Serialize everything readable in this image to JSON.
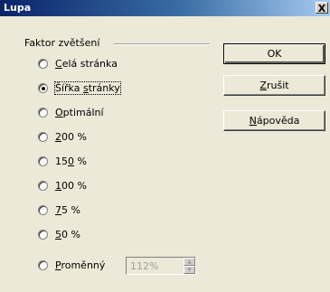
{
  "window": {
    "title": "Lupa",
    "close_label": "X"
  },
  "group": {
    "label": "Faktor zvětšení"
  },
  "options": [
    {
      "pre": "",
      "ul": "C",
      "post": "elá stránka",
      "checked": false
    },
    {
      "pre": "Šířka ",
      "ul": "s",
      "post": "tránky",
      "checked": true
    },
    {
      "pre": "",
      "ul": "O",
      "post": "ptimální",
      "checked": false
    },
    {
      "pre": "",
      "ul": "2",
      "post": "00 %",
      "checked": false
    },
    {
      "pre": "15",
      "ul": "0",
      "post": " %",
      "checked": false
    },
    {
      "pre": "",
      "ul": "1",
      "post": "00 %",
      "checked": false
    },
    {
      "pre": "",
      "ul": "7",
      "post": "5 %",
      "checked": false
    },
    {
      "pre": "",
      "ul": "5",
      "post": "0 %",
      "checked": false
    },
    {
      "pre": "",
      "ul": "P",
      "post": "roměnný",
      "checked": false
    }
  ],
  "variable_zoom": {
    "value": "112%"
  },
  "buttons": {
    "ok": "OK",
    "cancel_ul": "Z",
    "cancel_rest": "rušit",
    "help_ul": "N",
    "help_rest": "ápověda"
  }
}
